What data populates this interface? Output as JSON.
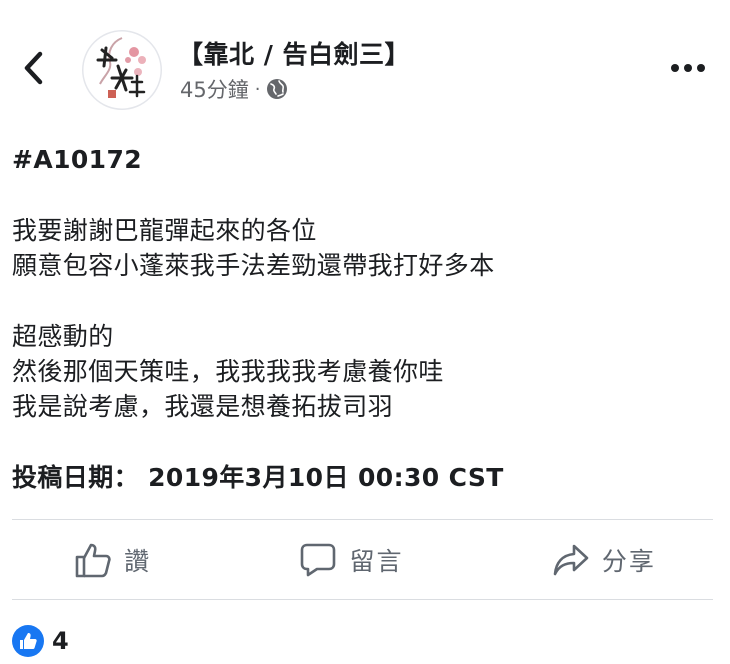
{
  "header": {
    "page_name": "【靠北 / 告白劍三】",
    "time": "45分鐘",
    "separator": "·",
    "back_icon": "chevron-left-icon",
    "privacy_icon": "globe-icon",
    "more_icon": "more-horizontal-icon"
  },
  "post": {
    "tag": "#A10172",
    "paragraphs": [
      [
        "我要謝謝巴龍彈起來的各位",
        "願意包容小蓬萊我手法差勁還帶我打好多本"
      ],
      [
        "超感動的",
        "然後那個天策哇，我我我我考慮養你哇",
        "我是說考慮，我還是想養拓拔司羽"
      ]
    ],
    "date_line": "投稿日期：  2019年3月10日 00:30 CST"
  },
  "actions": {
    "like_label": "讚",
    "comment_label": "留言",
    "share_label": "分享"
  },
  "reactions": {
    "count": "4",
    "icon": "like-icon",
    "color": "#1877f2"
  }
}
